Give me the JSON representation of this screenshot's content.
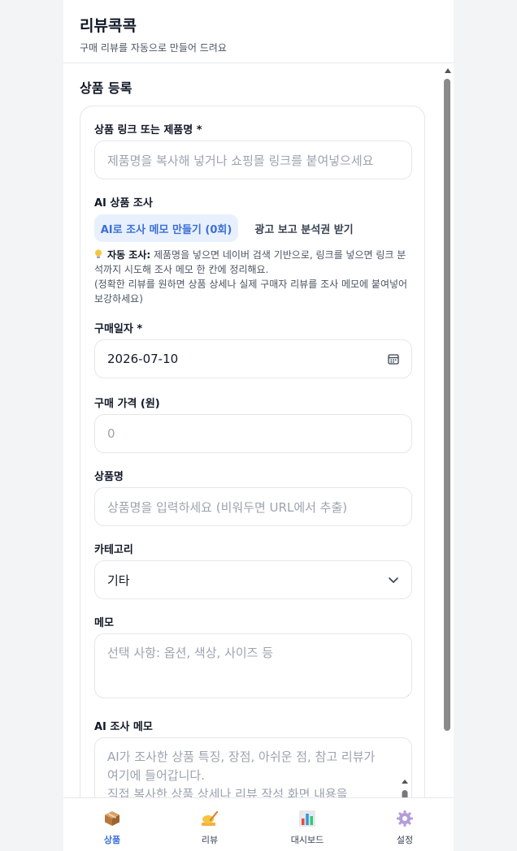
{
  "header": {
    "title": "리뷰콕콕",
    "subtitle": "구매 리뷰를 자동으로 만들어 드려요"
  },
  "section": {
    "title": "상품 등록"
  },
  "form": {
    "link": {
      "label": "상품 링크 또는 제품명 *",
      "placeholder": "제품명을 복사해 넣거나 쇼핑몰 링크를 붙여넣으세요"
    },
    "ai_research": {
      "label": "AI 상품 조사",
      "memo_button": "AI로 조사 메모 만들기 (0회)",
      "ad_button": "광고 보고 분석권 받기",
      "tip_icon": "lightbulb-icon",
      "tip_strong": "자동 조사:",
      "tip_text": " 제품명을 넣으면 네이버 검색 기반으로, 링크를 넣으면 링크 분석까지 시도해 조사 메모 한 칸에 정리해요.",
      "tip_note": "(정확한 리뷰를 원하면 상품 상세나 실제 구매자 리뷰를 조사 메모에 붙여넣어 보강하세요)"
    },
    "date": {
      "label": "구매일자 *",
      "value": "2026-07-10"
    },
    "price": {
      "label": "구매 가격 (원)",
      "placeholder": "0"
    },
    "name": {
      "label": "상품명",
      "placeholder": "상품명을 입력하세요 (비워두면 URL에서 추출)"
    },
    "category": {
      "label": "카테고리",
      "value": "기타"
    },
    "memo": {
      "label": "메모",
      "placeholder": "선택 사항: 옵션, 색상, 사이즈 등"
    },
    "ai_memo": {
      "label": "AI 조사 메모",
      "placeholder": "AI가 조사한 상품 특징, 장점, 아쉬운 점, 참고 리뷰가 여기에 들어갑니다.\n직접 복사한 상품 상세나 리뷰 작성 화면 내용을"
    }
  },
  "nav": {
    "items": [
      {
        "label": "상품",
        "active": true
      },
      {
        "label": "리뷰",
        "active": false
      },
      {
        "label": "대시보드",
        "active": false
      },
      {
        "label": "설정",
        "active": false
      }
    ]
  },
  "colors": {
    "accent": "#3b6fd8",
    "accent_bg": "#e8f0fd"
  }
}
